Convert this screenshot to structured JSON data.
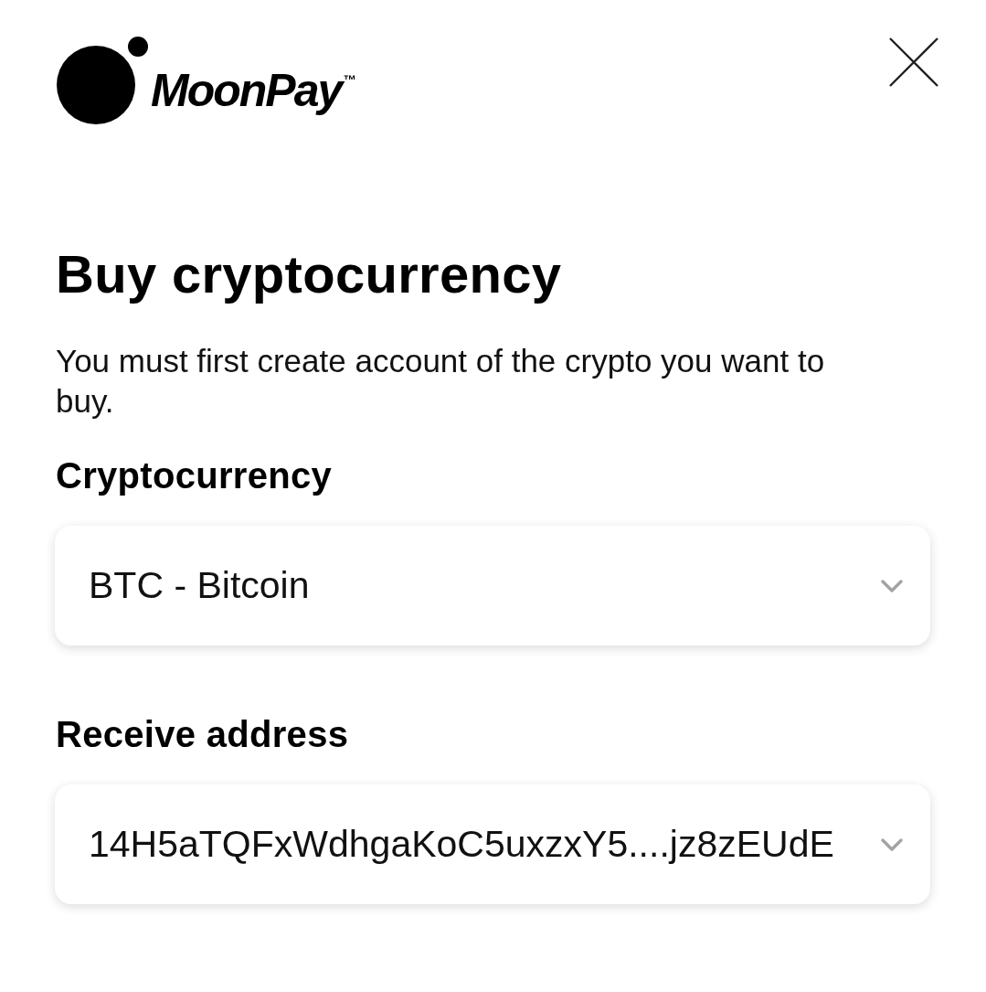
{
  "header": {
    "logo": {
      "wordmark": "MoonPay$^{™}$"
    }
  },
  "title": "Buy cryptocurrency",
  "description": "You must first create account of the crypto you want to buy.",
  "fields": [
    {
      "label": "Cryptocurrency",
      "value": "BTC - Bitcoin"
    },
    {
      "label": "Receive address",
      "value": "14H5aTQFxWdhgaKoC5uxzxY5....jz8zEUdE"
    }
  ]
}
